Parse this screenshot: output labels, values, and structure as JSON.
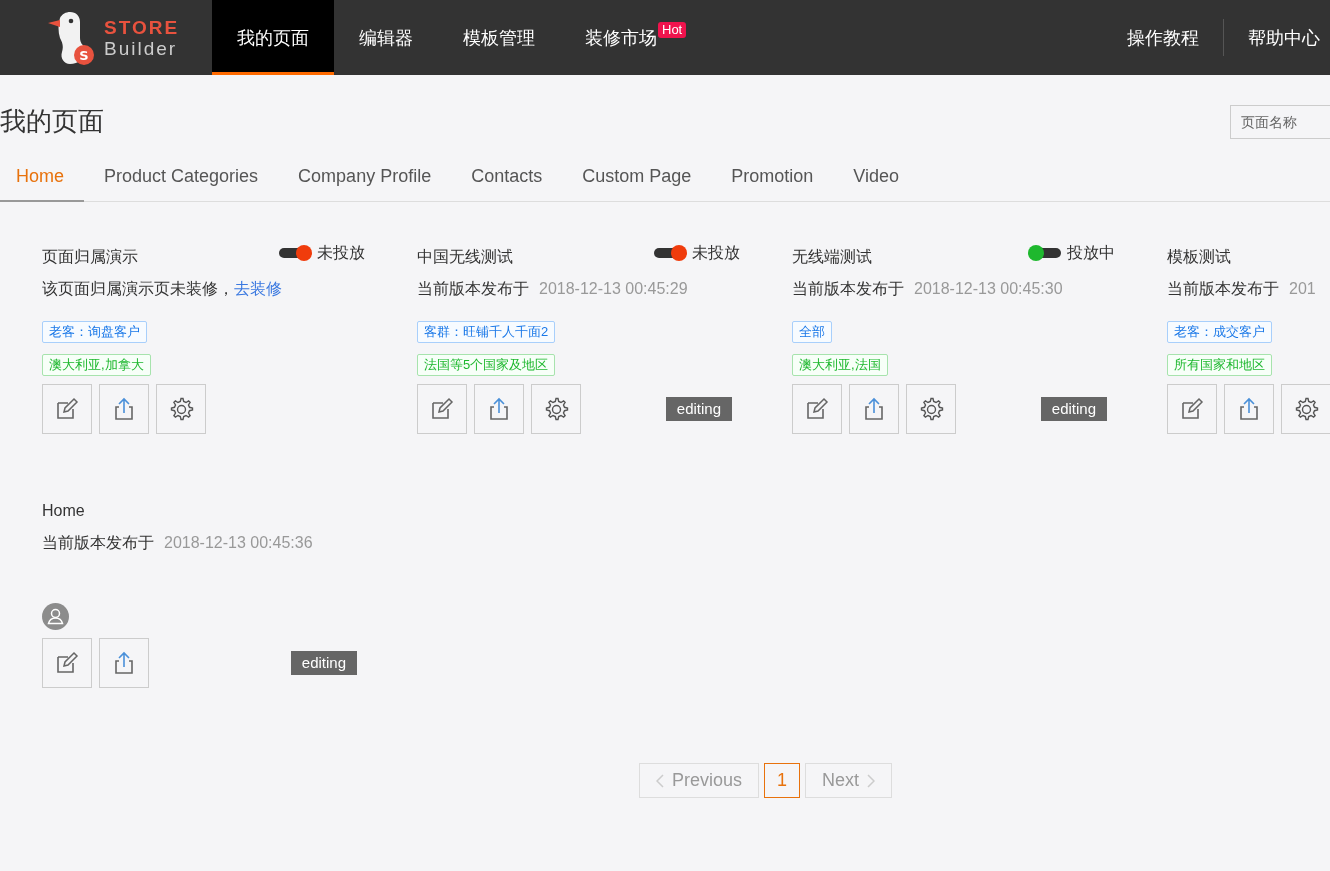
{
  "header": {
    "logo": {
      "badge": "S",
      "top": "STORE",
      "bottom": "Builder"
    },
    "nav": [
      {
        "label": "我的页面",
        "selected": true
      },
      {
        "label": "编辑器",
        "selected": false
      },
      {
        "label": "模板管理",
        "selected": false
      },
      {
        "label": "装修市场",
        "selected": false,
        "badge": "Hot"
      }
    ],
    "links": [
      "操作教程",
      "帮助中心"
    ]
  },
  "page_title": "我的页面",
  "search": {
    "placeholder": "页面名称"
  },
  "tabs": [
    {
      "label": "Home",
      "selected": true
    },
    {
      "label": "Product Categories",
      "selected": false
    },
    {
      "label": "Company Profile",
      "selected": false
    },
    {
      "label": "Contacts",
      "selected": false
    },
    {
      "label": "Custom Page",
      "selected": false
    },
    {
      "label": "Promotion",
      "selected": false
    },
    {
      "label": "Video",
      "selected": false
    }
  ],
  "cards": [
    {
      "title": "页面归属演示",
      "toggle": {
        "on": false,
        "label": "未投放"
      },
      "subtitle": {
        "kind": "note",
        "text": "该页面归属演示页未装修，",
        "link": "去装修"
      },
      "tags": [
        {
          "kind": "audience",
          "text": "老客：询盘客户"
        },
        {
          "kind": "region",
          "text": "澳大利亚,加拿大"
        }
      ],
      "actions": [
        {
          "kind": "edit"
        },
        {
          "kind": "share"
        },
        {
          "kind": "settings"
        }
      ]
    },
    {
      "title": "中国无线测试",
      "toggle": {
        "on": false,
        "label": "未投放"
      },
      "subtitle": {
        "kind": "published",
        "text": "当前版本发布于",
        "date": "2018-12-13 00:45:29"
      },
      "tags": [
        {
          "kind": "audience",
          "text": "客群：旺铺千人千面2"
        },
        {
          "kind": "region",
          "text": "法国等5个国家及地区"
        }
      ],
      "actions": [
        {
          "kind": "edit"
        },
        {
          "kind": "share"
        },
        {
          "kind": "settings"
        }
      ],
      "badge": "editing"
    },
    {
      "title": "无线端测试",
      "toggle": {
        "on": true,
        "label": "投放中"
      },
      "subtitle": {
        "kind": "published",
        "text": "当前版本发布于",
        "date": "2018-12-13 00:45:30"
      },
      "tags": [
        {
          "kind": "audience",
          "text": "全部"
        },
        {
          "kind": "region",
          "text": "澳大利亚,法国"
        }
      ],
      "actions": [
        {
          "kind": "edit"
        },
        {
          "kind": "share"
        },
        {
          "kind": "settings"
        }
      ],
      "badge": "editing"
    },
    {
      "title": "模板测试",
      "subtitle": {
        "kind": "published",
        "text": "当前版本发布于",
        "date": "201"
      },
      "tags": [
        {
          "kind": "audience",
          "text": "老客：成交客户"
        },
        {
          "kind": "region",
          "text": "所有国家和地区"
        }
      ],
      "actions": [
        {
          "kind": "edit"
        },
        {
          "kind": "share"
        },
        {
          "kind": "settings"
        }
      ]
    },
    {
      "title": "Home",
      "subtitle": {
        "kind": "published",
        "text": "当前版本发布于",
        "date": "2018-12-13 00:45:36"
      },
      "owner": true,
      "actions": [
        {
          "kind": "edit"
        },
        {
          "kind": "share"
        }
      ],
      "badge": "editing"
    }
  ],
  "pagination": {
    "previous": "Previous",
    "pages": [
      {
        "label": "1",
        "selected": true
      }
    ],
    "next": "Next"
  }
}
